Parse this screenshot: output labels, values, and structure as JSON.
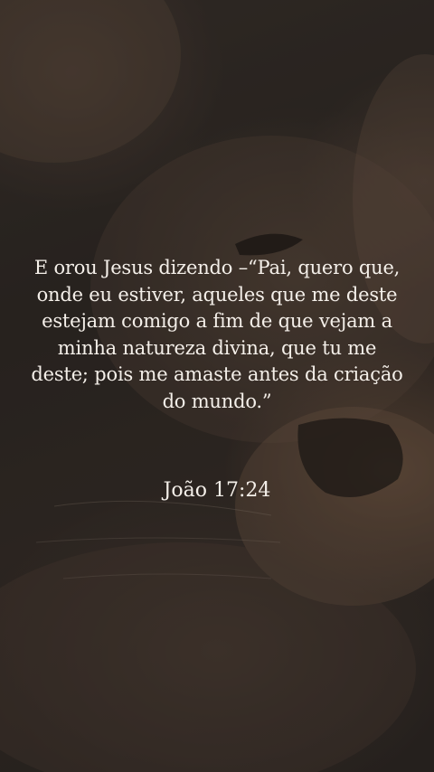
{
  "verse": {
    "text": "E orou Jesus dizendo –“Pai, quero que, onde eu estiver, aqueles que me deste estejam comigo a fim de que vejam a minha natureza divina, que tu me deste; pois me amaste antes da criação do mundo.”",
    "reference": "João 17:24"
  },
  "background": {
    "subject": "lion-face-photo",
    "tone": "#2e2824"
  }
}
